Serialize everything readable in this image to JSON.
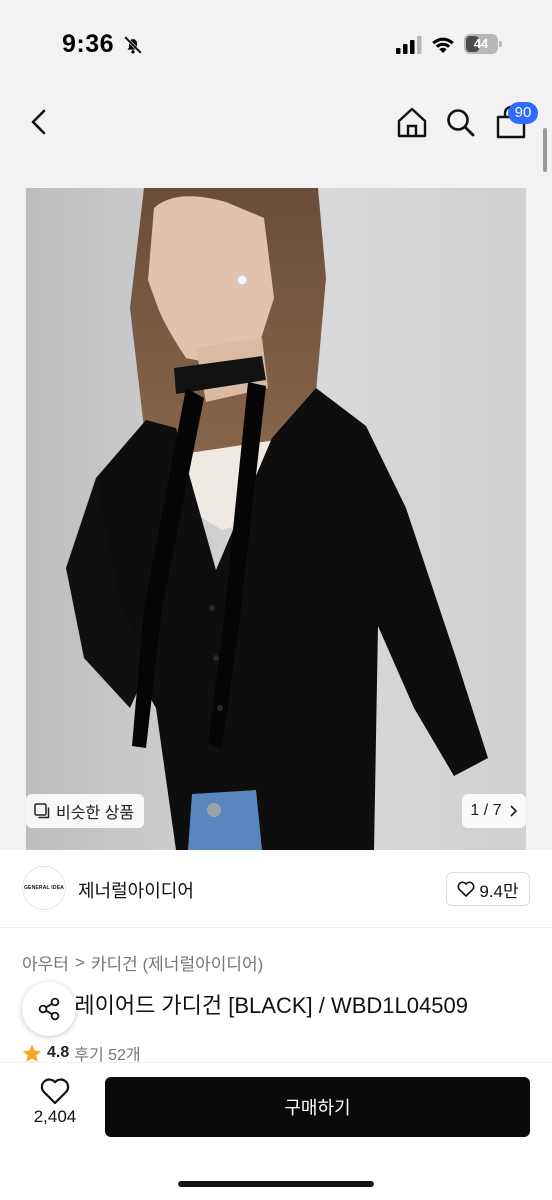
{
  "status_bar": {
    "time": "9:36",
    "battery": "44",
    "battery_level": 0.44,
    "icons": [
      "bell-slash-icon",
      "cellular-signal-icon",
      "wifi-icon",
      "battery-icon"
    ]
  },
  "nav": {
    "icons": [
      "chevron-left-icon",
      "home-icon",
      "search-icon",
      "shopping-bag-icon"
    ],
    "cart_badge": "90",
    "accent_color": "#2f6bff"
  },
  "gallery": {
    "similar_label": "비슷한 상품",
    "pager": "1 / 7",
    "pager_current": 1,
    "pager_total": 7
  },
  "brand": {
    "logo_text": "GENERAL IDEA",
    "name": "제너럴아이디어",
    "likes": "9.4만"
  },
  "breadcrumb": {
    "category": "아우터",
    "separator": ">",
    "subcategory": "카디건 (제너럴아이디어)"
  },
  "product": {
    "title": "프 레이어드 가디건 [BLACK] / WBD1L04509",
    "rating": "4.8",
    "reviews": "후기 52개",
    "star_color": "#f5a623"
  },
  "bottom": {
    "wish_count": "2,404",
    "buy_label": "구매하기"
  }
}
